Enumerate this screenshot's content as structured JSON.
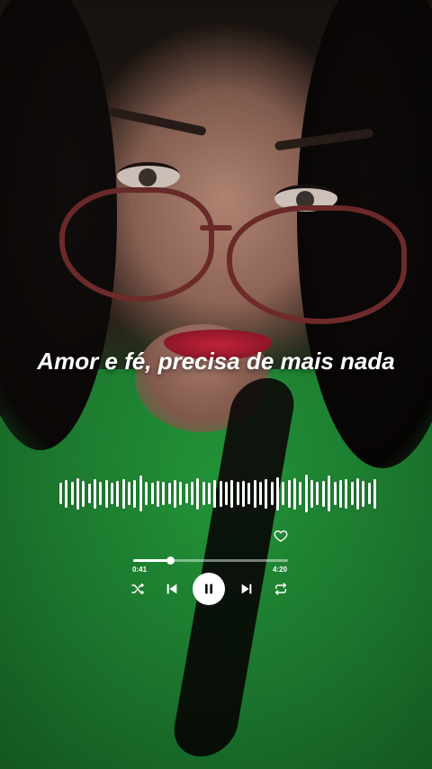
{
  "lyrics": {
    "line": "Amor e fé, precisa de mais nada"
  },
  "player": {
    "elapsed": "0:41",
    "total": "4:20",
    "progress_fraction": 0.24,
    "liked": false,
    "is_playing": true
  },
  "icons": {
    "like": "heart-outline-icon",
    "shuffle": "shuffle-icon",
    "previous": "skip-previous-icon",
    "play_pause": "pause-icon",
    "next": "skip-next-icon",
    "repeat": "repeat-icon"
  },
  "colors": {
    "overlay_text": "#ffffff",
    "shirt_green": "#1d7c30",
    "lip_red": "#c2233a"
  }
}
